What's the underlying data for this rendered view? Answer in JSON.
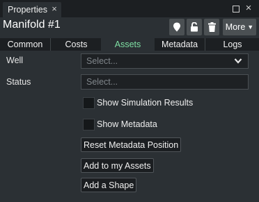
{
  "window": {
    "tab_label": "Properties",
    "tab_close_icon": "close-icon",
    "controls": [
      "maximize-icon",
      "close-icon"
    ]
  },
  "header": {
    "title": "Manifold #1",
    "tools": [
      "map-pin-icon",
      "unlock-icon",
      "trash-icon"
    ],
    "more_label": "More"
  },
  "tabs": [
    {
      "label": "Common"
    },
    {
      "label": "Costs"
    },
    {
      "label": "Assets",
      "active": true
    },
    {
      "label": "Metadata"
    },
    {
      "label": "Logs"
    }
  ],
  "form": {
    "well": {
      "label": "Well",
      "placeholder": "Select..."
    },
    "status": {
      "label": "Status",
      "placeholder": "Select..."
    },
    "checkboxes": [
      {
        "label": "Show Simulation Results",
        "checked": false
      },
      {
        "label": "Show Metadata",
        "checked": false
      }
    ],
    "buttons": [
      {
        "label": "Reset Metadata Position"
      },
      {
        "label": "Add to my Assets"
      },
      {
        "label": "Add a Shape"
      }
    ]
  },
  "colors": {
    "background": "#2b3034",
    "title_bar": "#1c1f22",
    "active_tab_text": "#7fe0a4",
    "input_background": "#1e2124"
  }
}
